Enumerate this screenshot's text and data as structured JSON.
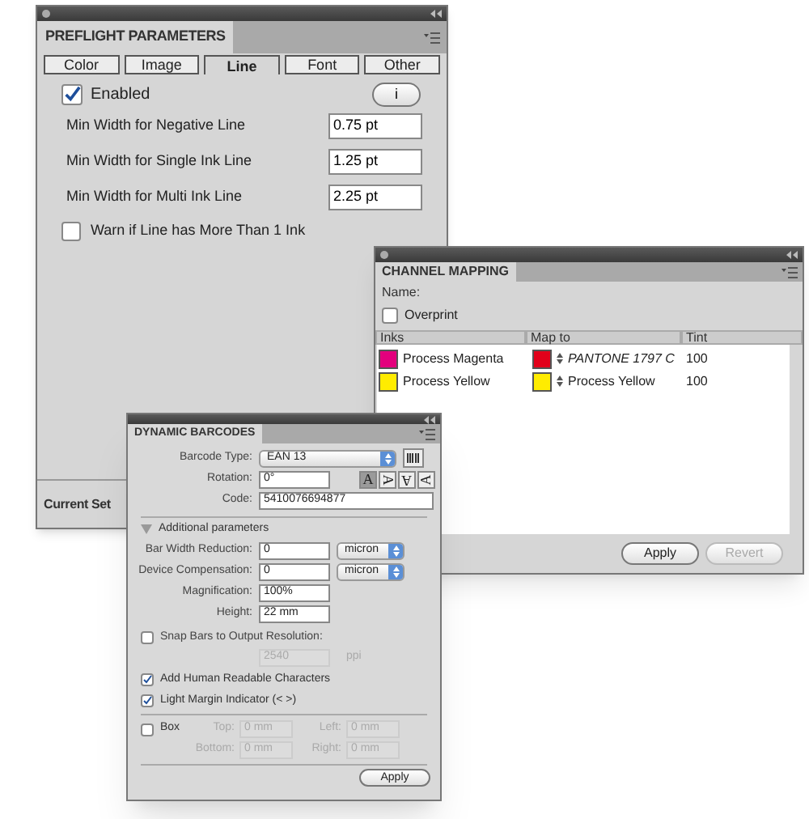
{
  "preflight": {
    "title": "PREFLIGHT PARAMETERS",
    "tabs": [
      {
        "label": "Color",
        "selected": false
      },
      {
        "label": "Image",
        "selected": false
      },
      {
        "label": "Line",
        "selected": true
      },
      {
        "label": "Font",
        "selected": false
      },
      {
        "label": "Other",
        "selected": false
      }
    ],
    "enabled": {
      "label": "Enabled",
      "checked": true
    },
    "info_button": "i",
    "fields": [
      {
        "label": "Min Width for Negative Line",
        "value": "0.75 pt"
      },
      {
        "label": "Min Width for Single Ink Line",
        "value": "1.25 pt"
      },
      {
        "label": "Min Width for Multi Ink Line",
        "value": "2.25 pt"
      }
    ],
    "warn": {
      "label": "Warn if Line has More Than 1 Ink",
      "checked": false
    },
    "footer_label": "Current Set"
  },
  "channel_mapping": {
    "title": "CHANNEL MAPPING",
    "name_label": "Name:",
    "overprint": {
      "label": "Overprint",
      "checked": false
    },
    "columns": [
      "Inks",
      "Map to",
      "Tint"
    ],
    "rows": [
      {
        "ink": {
          "name": "Process Magenta",
          "color": "#e3007d"
        },
        "map_to": {
          "name": "PANTONE 1797 C",
          "color": "#e2001a",
          "italic": true
        },
        "tint": "100"
      },
      {
        "ink": {
          "name": "Process Yellow",
          "color": "#ffec00"
        },
        "map_to": {
          "name": "Process Yellow",
          "color": "#ffec00",
          "italic": false
        },
        "tint": "100"
      }
    ],
    "buttons": [
      {
        "label": "Apply",
        "disabled": false
      },
      {
        "label": "Revert",
        "disabled": true
      }
    ]
  },
  "barcodes": {
    "title": "DYNAMIC BARCODES",
    "barcode_type": {
      "label": "Barcode Type:",
      "value": "EAN 13"
    },
    "rotation": {
      "label": "Rotation:",
      "value": "0°"
    },
    "orientations": [
      {
        "glyph": "A",
        "selected": true
      },
      {
        "glyph": "A",
        "selected": false
      },
      {
        "glyph": "A",
        "selected": false
      },
      {
        "glyph": "A",
        "selected": false
      }
    ],
    "code": {
      "label": "Code:",
      "value": "5410076694877"
    },
    "additional": {
      "label": "Additional parameters",
      "expanded": true
    },
    "params": [
      {
        "label": "Bar Width Reduction:",
        "value": "0",
        "unit": "micron"
      },
      {
        "label": "Device Compensation:",
        "value": "0",
        "unit": "micron"
      },
      {
        "label": "Magnification:",
        "value": "100%"
      },
      {
        "label": "Height:",
        "value": "22 mm"
      }
    ],
    "snap": {
      "label": "Snap Bars to Output Resolution:",
      "checked": false,
      "value": "2540",
      "unit": "ppi"
    },
    "options": [
      {
        "label": "Add Human Readable Characters",
        "checked": true
      },
      {
        "label": "Light Margin Indicator (< >)",
        "checked": true
      }
    ],
    "box": {
      "label": "Box",
      "checked": false,
      "fields": [
        {
          "label": "Top:",
          "value": "0 mm"
        },
        {
          "label": "Left:",
          "value": "0 mm"
        },
        {
          "label": "Bottom:",
          "value": "0 mm"
        },
        {
          "label": "Right:",
          "value": "0 mm"
        }
      ]
    },
    "apply_button": "Apply"
  }
}
